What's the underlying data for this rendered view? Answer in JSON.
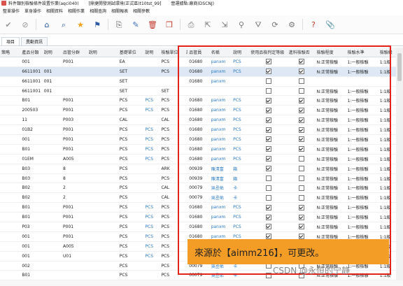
{
  "window": {
    "title": "料件類別檢驗條件設置作業(aqci040)",
    "env": "[鼎捷開發測試環境(正式區)t10tst_99]",
    "company": "營運據點:廠商(DSCNJ)"
  },
  "menu": [
    "整單操作",
    "單身操作",
    "相關資料",
    "相關作業",
    "相關查詢",
    "相關報表",
    "相關參數"
  ],
  "toolbar_icons": [
    "check-icon",
    "cancel-icon",
    "home-icon",
    "search-icon",
    "star-icon",
    "flag-icon",
    "new-icon",
    "edit-icon",
    "delete-icon",
    "copy-icon",
    "print-icon",
    "export-icon",
    "import-icon",
    "query-icon",
    "filter-icon",
    "refresh-icon",
    "settings-icon",
    "help-icon",
    "attach-icon"
  ],
  "tabs": [
    "項目",
    "異動資訊"
  ],
  "columns": [
    "策略",
    "產品分類",
    "說明",
    "品管分群",
    "說明",
    "基礎單位",
    "說明",
    "檢驗單位",
    "說明",
    "品管員",
    "名稱",
    "說明",
    "使用品檢判定等級",
    "進料檢驗否",
    "檢驗程度",
    "檢驗水準",
    "檢驗級"
  ],
  "rows": [
    {
      "c": [
        "",
        "001",
        "",
        "P001",
        "",
        "EA",
        "",
        "PCS",
        "",
        "01680",
        "panxm",
        "PCS"
      ],
      "a": true,
      "b": true,
      "d": "N:正常檢驗",
      "e": "1:一般檢驗",
      "f": "1:1級"
    },
    {
      "c": [
        "",
        "6611001",
        "001",
        "",
        "",
        "SET",
        "",
        "PCS",
        "",
        "01680",
        "panxm",
        "PCS"
      ],
      "a": true,
      "b": true,
      "d": "N:正常檢驗",
      "e": "1:一般檢驗",
      "f": "1:1級",
      "sel": true
    },
    {
      "c": [
        "",
        "6611001",
        "001",
        "",
        "",
        "SET",
        "",
        "",
        "",
        "01680",
        "panxm",
        ""
      ],
      "a": false,
      "b": false,
      "d": "",
      "e": "",
      "f": ""
    },
    {
      "c": [
        "",
        "6611001",
        "001",
        "",
        "",
        "SET",
        "",
        "SET",
        "",
        "",
        "",
        ""
      ],
      "a": false,
      "b": false,
      "d": "N:正常檢驗",
      "e": "1:一般檢驗",
      "f": "1:1級"
    },
    {
      "c": [
        "",
        "B01",
        "",
        "P001",
        "",
        "PCS",
        "PCS",
        "PCS",
        "",
        "01680",
        "panxm",
        "PCS"
      ],
      "a": true,
      "b": true,
      "d": "N:正常檢驗",
      "e": "1:一般檢驗",
      "f": "1:1級"
    },
    {
      "c": [
        "",
        "200503",
        "",
        "P001",
        "",
        "PCS",
        "PCS",
        "PCS",
        "",
        "01680",
        "panxm",
        "PCS"
      ],
      "a": true,
      "b": true,
      "d": "N:正常檢驗",
      "e": "1:一般檢驗",
      "f": "1:1級"
    },
    {
      "c": [
        "",
        "11",
        "",
        "P003",
        "",
        "CAL",
        "",
        "CAL",
        "",
        "01680",
        "panxm",
        "PCS"
      ],
      "a": true,
      "b": true,
      "d": "N:正常檢驗",
      "e": "1:一般檢驗",
      "f": "1:1級"
    },
    {
      "c": [
        "",
        "01B2",
        "",
        "P001",
        "",
        "PCS",
        "PCS",
        "PCS",
        "",
        "01680",
        "panxm",
        "PCS"
      ],
      "a": true,
      "b": true,
      "d": "N:正常檢驗",
      "e": "1:一般檢驗",
      "f": "1:1級"
    },
    {
      "c": [
        "",
        "001",
        "",
        "P001",
        "",
        "PCS",
        "PCS",
        "PCS",
        "",
        "01680",
        "panxm",
        "PCS"
      ],
      "a": true,
      "b": true,
      "d": "N:正常檢驗",
      "e": "1:一般檢驗",
      "f": "1:1級"
    },
    {
      "c": [
        "",
        "B01",
        "",
        "P001",
        "",
        "PCS",
        "PCS",
        "PCS",
        "",
        "01680",
        "panxm",
        "PCS"
      ],
      "a": true,
      "b": true,
      "d": "N:正常檢驗",
      "e": "1:一般檢驗",
      "f": "1:1級"
    },
    {
      "c": [
        "",
        "01EM",
        "",
        "A005",
        "",
        "PCS",
        "PCS",
        "PCS",
        "",
        "01680",
        "panxm",
        "PCS"
      ],
      "a": true,
      "b": false,
      "d": "N:正常檢驗",
      "e": "1:一般檢驗",
      "f": "1:1級"
    },
    {
      "c": [
        "",
        "B03",
        "",
        "8",
        "",
        "PCS",
        "",
        "ARK",
        "",
        "00939",
        "陳淸富",
        "箱"
      ],
      "a": true,
      "b": false,
      "d": "N:正常檢驗",
      "e": "1:一般檢驗",
      "f": "1:1級"
    },
    {
      "c": [
        "",
        "B03",
        "",
        "8",
        "",
        "PCS",
        "",
        "PCS",
        "",
        "00939",
        "陳淸富",
        "箱"
      ],
      "a": false,
      "b": false,
      "d": "N:正常檢驗",
      "e": "1:一般檢驗",
      "f": "1:1級"
    },
    {
      "c": [
        "",
        "B02",
        "",
        "2",
        "",
        "PCS",
        "",
        "CAL",
        "",
        "00079",
        "吳丞佑",
        "卡"
      ],
      "a": false,
      "b": false,
      "d": "N:正常檢驗",
      "e": "1:一般檢驗",
      "f": "1:1級"
    },
    {
      "c": [
        "",
        "B02",
        "",
        "2",
        "",
        "PCS",
        "",
        "CAL",
        "",
        "00079",
        "吳丞佑",
        "卡"
      ],
      "a": false,
      "b": false,
      "d": "N:正常檢驗",
      "e": "1:一般檢驗",
      "f": "1:1級"
    },
    {
      "c": [
        "",
        "B01",
        "",
        "P001",
        "",
        "PCS",
        "PCS",
        "PCS",
        "",
        "01680",
        "panxm",
        "PCS"
      ],
      "a": true,
      "b": true,
      "d": "N:正常檢驗",
      "e": "1:一般檢驗",
      "f": "1:1級"
    },
    {
      "c": [
        "",
        "B01",
        "",
        "P001",
        "",
        "PCS",
        "PCS",
        "PCS",
        "",
        "01680",
        "panxm",
        "PCS"
      ],
      "a": true,
      "b": true,
      "d": "N:正常檢驗",
      "e": "1:一般檢驗",
      "f": "1:1級"
    },
    {
      "c": [
        "",
        "P03",
        "",
        "P001",
        "",
        "PCS",
        "PCS",
        "PCS",
        "",
        "01680",
        "panxm",
        "PCS"
      ],
      "a": true,
      "b": true,
      "d": "N:正常檢驗",
      "e": "1:一般檢驗",
      "f": "1:1級"
    },
    {
      "c": [
        "",
        "001",
        "",
        "P001",
        "",
        "PCS",
        "PCS",
        "PCS",
        "",
        "01680",
        "panxm",
        "PCS"
      ],
      "a": true,
      "b": true,
      "d": "N:正常檢驗",
      "e": "1:一般檢驗",
      "f": "1:1級"
    },
    {
      "c": [
        "",
        "001",
        "",
        "A005",
        "",
        "PCS",
        "PCS",
        "PCS",
        "",
        "01680",
        "panxm",
        "PCS"
      ],
      "a": true,
      "b": true,
      "d": "N:正常檢驗",
      "e": "1:一般檢驗",
      "f": "1:1級"
    },
    {
      "c": [
        "",
        "001",
        "",
        "U01",
        "",
        "PCS",
        "PCS",
        "PCS",
        "",
        "01680",
        "panxm",
        "PCS"
      ],
      "a": true,
      "b": true,
      "d": "N:正常檢驗",
      "e": "1:一般檢驗",
      "f": "1:1級"
    },
    {
      "c": [
        "",
        "002",
        "",
        "",
        "",
        "PCS",
        "",
        "PCS",
        "",
        "00079",
        "吳丞佑",
        "卡"
      ],
      "a": false,
      "b": false,
      "d": "N:正常檢驗",
      "e": "1:一般檢驗",
      "f": "1:1級"
    },
    {
      "c": [
        "",
        "B01",
        "",
        "",
        "",
        "PCS",
        "",
        "PCS",
        "",
        "00079",
        "吳丞佑",
        "卡"
      ],
      "a": false,
      "b": false,
      "d": "N:正常檢驗",
      "e": "1:一般檢驗",
      "f": "1:1級"
    },
    {
      "c": [
        "",
        "B01",
        "",
        "",
        "",
        "PCS",
        "",
        "PCS",
        "",
        "00079",
        "吳丞佑",
        "卡"
      ],
      "a": false,
      "b": false,
      "d": "N:正常檢驗",
      "e": "1:一般檢驗",
      "f": "1:1級"
    }
  ],
  "annotation": "來源於【aimm216】，可更改。",
  "watermark": "CSDN @永恒的宁静"
}
